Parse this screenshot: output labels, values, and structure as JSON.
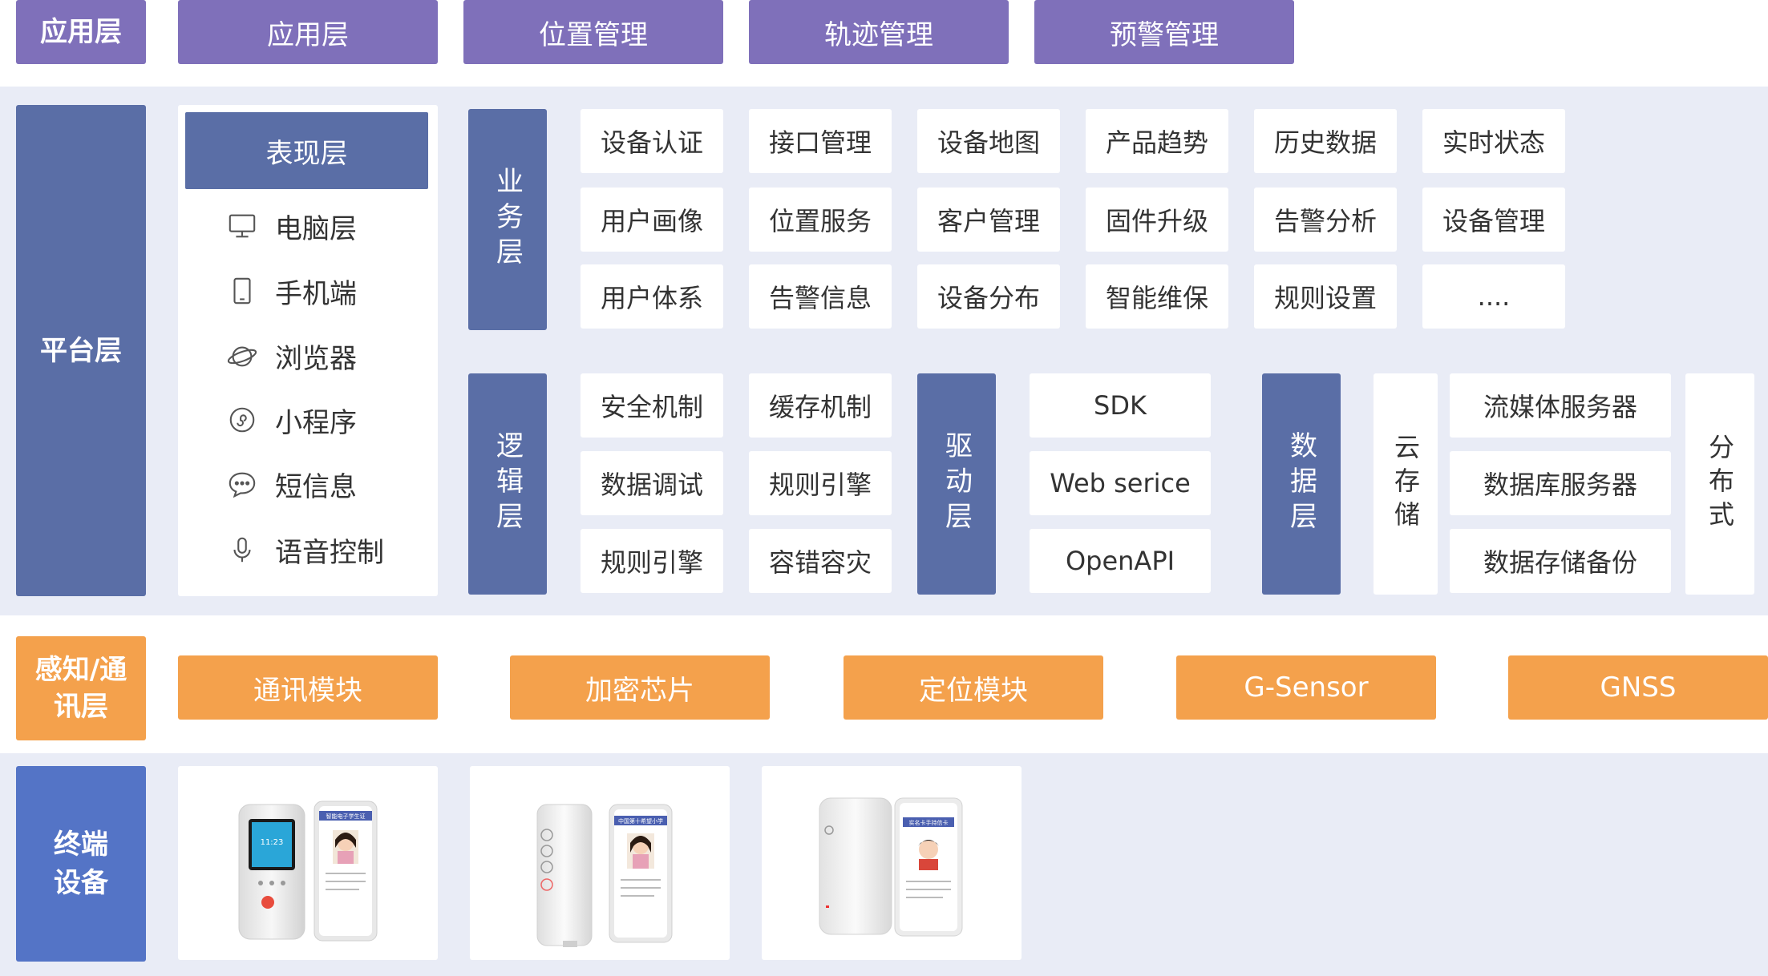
{
  "app_layer": {
    "label": "应用层",
    "items": [
      "应用层",
      "位置管理",
      "轨迹管理",
      "预警管理"
    ]
  },
  "platform_layer": {
    "label": "平台层",
    "presentation": {
      "title": "表现层",
      "items": [
        {
          "icon": "monitor-icon",
          "label": "电脑层"
        },
        {
          "icon": "phone-icon",
          "label": "手机端"
        },
        {
          "icon": "browser-globe-icon",
          "label": "浏览器"
        },
        {
          "icon": "mini-program-icon",
          "label": "小程序"
        },
        {
          "icon": "message-bubble-icon",
          "label": "短信息"
        },
        {
          "icon": "microphone-icon",
          "label": "语音控制"
        }
      ]
    },
    "business": {
      "label": "业务层",
      "rows": [
        [
          "设备认证",
          "接口管理",
          "设备地图",
          "产品趋势",
          "历史数据",
          "实时状态"
        ],
        [
          "用户画像",
          "位置服务",
          "客户管理",
          "固件升级",
          "告警分析",
          "设备管理"
        ],
        [
          "用户体系",
          "告警信息",
          "设备分布",
          "智能维保",
          "规则设置",
          "...."
        ]
      ]
    },
    "logic": {
      "label": "逻辑层",
      "col1": [
        "安全机制",
        "数据调试",
        "规则引擎"
      ],
      "col2": [
        "缓存机制",
        "规则引擎",
        "容错容灾"
      ]
    },
    "driver": {
      "label": "驱动层",
      "items": [
        "SDK",
        "Web serice",
        "OpenAPI"
      ]
    },
    "data": {
      "label": "数据层",
      "cloud": "云存储",
      "items": [
        "流媒体服务器",
        "数据库服务器",
        "数据存储备份"
      ],
      "distributed": "分布式"
    }
  },
  "sensing_layer": {
    "label": "感知/通讯层",
    "items": [
      "通讯模块",
      "加密芯片",
      "定位模块",
      "G-Sensor",
      "GNSS"
    ]
  },
  "terminal_layer": {
    "label": "终端设备",
    "card_texts": {
      "card1_screen": "智能电子学生证",
      "card1_time": "11:23",
      "card2_screen": "中国第十希望小学",
      "card3_screen": "实名卡手持信卡"
    }
  },
  "colors": {
    "purple": "#7f70ba",
    "slate": "#5a6ea6",
    "orange": "#f4a14c",
    "blue": "#5474c6",
    "band": "#e9ecf6"
  }
}
